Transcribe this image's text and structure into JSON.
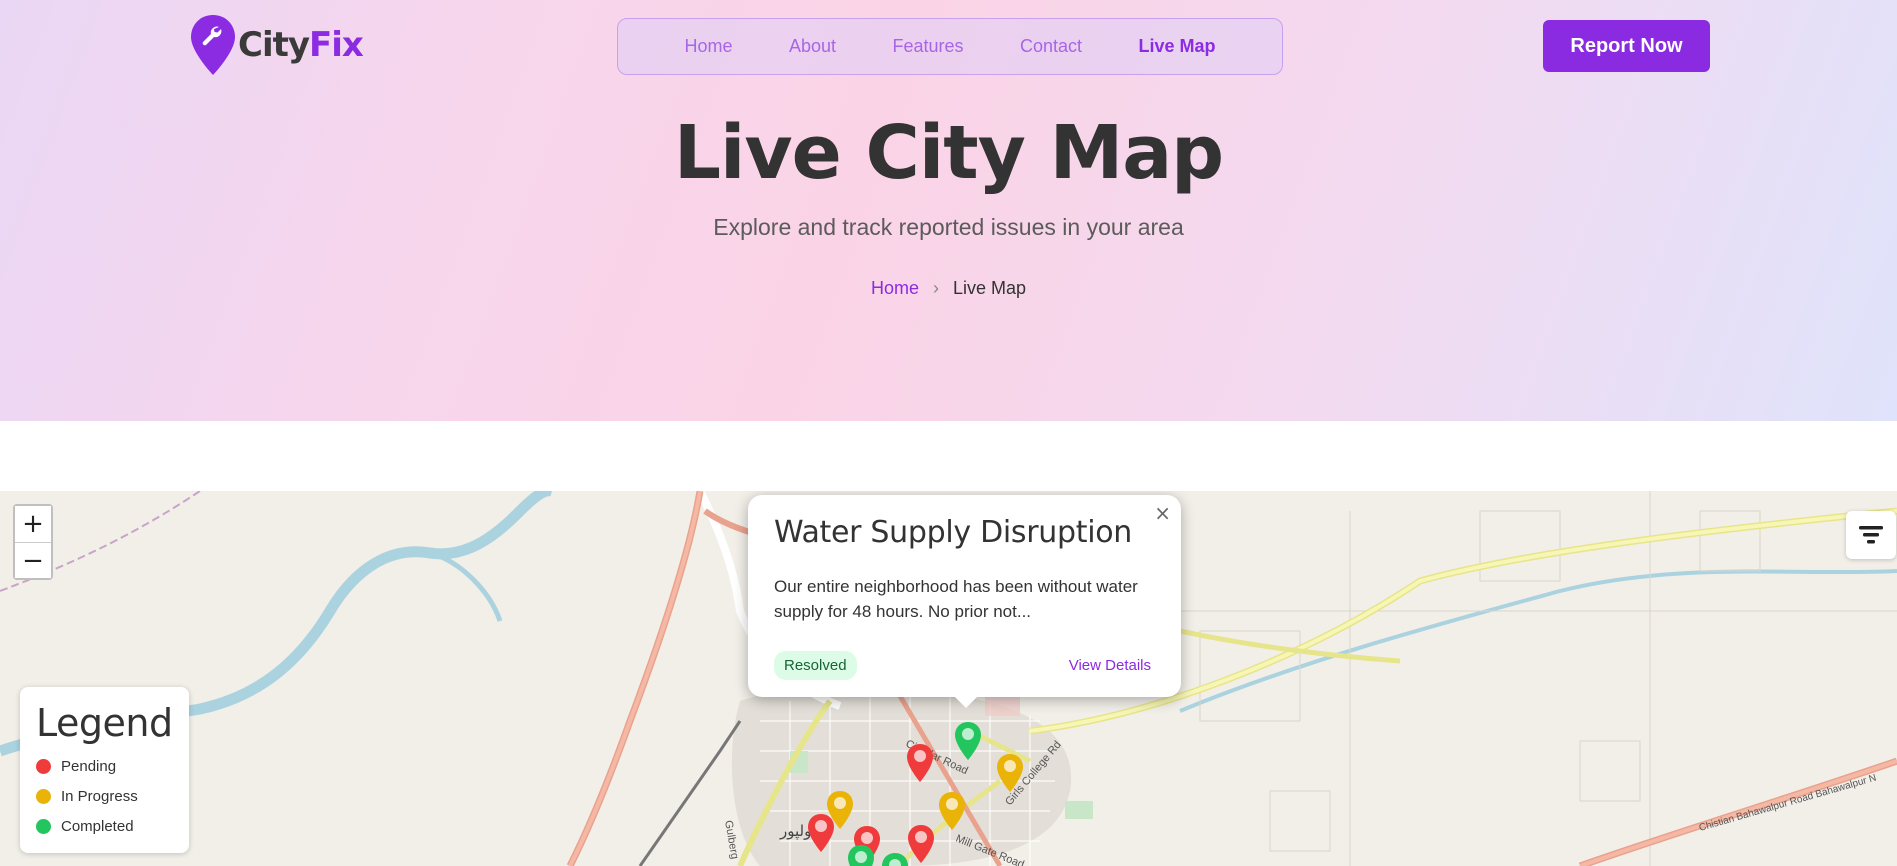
{
  "brand": {
    "part1": "City",
    "part2": "Fix",
    "icon": "wrench-pin-icon",
    "color": "#8b2be2"
  },
  "nav": {
    "items": [
      {
        "label": "Home"
      },
      {
        "label": "About"
      },
      {
        "label": "Features"
      },
      {
        "label": "Contact"
      },
      {
        "label": "Live Map",
        "active": true
      }
    ]
  },
  "cta": {
    "label": "Report Now"
  },
  "hero": {
    "title": "Live City Map",
    "subtitle": "Explore and track reported issues in your area",
    "breadcrumb": {
      "home": "Home",
      "separator": "›",
      "current": "Live Map"
    }
  },
  "map": {
    "zoom_in": "+",
    "zoom_out": "−",
    "filter_icon": "filter-icon",
    "legend": {
      "title": "Legend",
      "items": [
        {
          "label": "Pending",
          "color": "#ef3b3b"
        },
        {
          "label": "In Progress",
          "color": "#eab308"
        },
        {
          "label": "Completed",
          "color": "#22c55e"
        }
      ]
    },
    "popup": {
      "title": "Water Supply Disruption",
      "description": "Our entire neighborhood has been without water supply for 48 hours. No prior not...",
      "status": "Resolved",
      "link": "View Details",
      "close": "×"
    },
    "street_labels": [
      "Circular Road",
      "Girls College Rd",
      "Gulberg",
      "Mill Gate Road",
      "Chistian Bahawalpur Road Bahawalpur N",
      "بہاولپور"
    ]
  }
}
